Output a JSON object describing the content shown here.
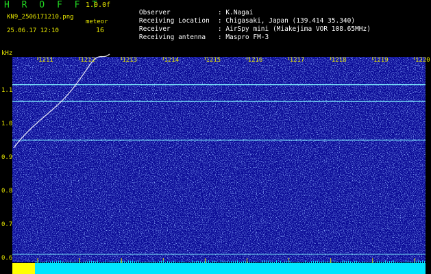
{
  "header": {
    "brand": "H R O F F T",
    "version": "1.0.0f",
    "filename": "KN9_2506171210.png",
    "meteor_label": "meteor",
    "datetime": "25.06.17 12:10",
    "count": "16"
  },
  "info": [
    {
      "label": "Observer",
      "value": ": K.Nagai"
    },
    {
      "label": "Receiving Location",
      "value": ": Chigasaki, Japan (139.414 35.340)"
    },
    {
      "label": "Receiver",
      "value": ": AirSpy mini (Miakejima VOR 108.65MHz)"
    },
    {
      "label": "Receiving antenna",
      "value": ": Maspro FM-3"
    }
  ],
  "spectrogram": {
    "freq_unit": "kHz",
    "freq_ticks": [
      "1.1",
      "1.0",
      "0.9",
      "0.8",
      "0.7",
      "0.6"
    ],
    "freq_tick_values": [
      1.1,
      1.0,
      0.9,
      0.8,
      0.7,
      0.6
    ],
    "time_ticks": [
      "1211",
      "1212",
      "1213",
      "1214",
      "1215",
      "1216",
      "1217",
      "1218",
      "1219",
      "1220"
    ],
    "carrier_lines_khz": [
      1.115,
      1.065,
      0.95,
      0.61
    ],
    "colors": {
      "background": "#0a0a96",
      "noise": "#4a6cff",
      "carrier": "#7ef0ff",
      "trace": "#ffffff",
      "strip": "#00e5ff",
      "strip_marker": "#ffff00",
      "text": "#e8e800"
    }
  }
}
